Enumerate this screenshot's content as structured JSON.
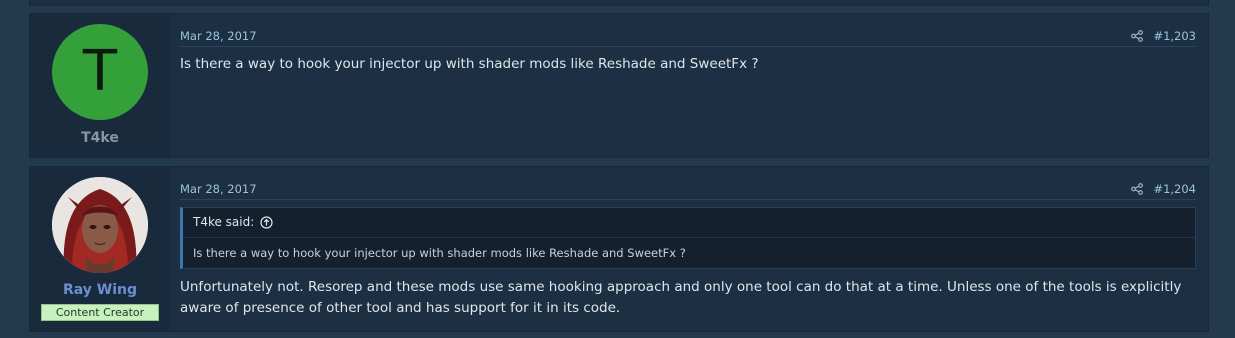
{
  "posts": [
    {
      "avatar_letter": "T",
      "username": "T4ke",
      "date": "Mar 28, 2017",
      "number": "#1,203",
      "body": "Is there a way to hook your injector up with shader mods like Reshade and SweetFx ?"
    },
    {
      "username": "Ray Wing",
      "badge": "Content Creator",
      "date": "Mar 28, 2017",
      "number": "#1,204",
      "quote": {
        "author": "T4ke said:",
        "text": "Is there a way to hook your injector up with shader mods like Reshade and SweetFx ?"
      },
      "body_lines": [
        "Unfortunately not. Resorep and these mods use same hooking approach and only one tool can do that at a time. Unless one of the tools is explicitly",
        "aware of presence of other tool and has support for it in its code."
      ]
    }
  ],
  "colors": {
    "accent_link": "#9ec3de",
    "avatar_green": "#33a03a",
    "badge_bg": "#c8f0c0",
    "username_blue": "#6b8fd1"
  }
}
